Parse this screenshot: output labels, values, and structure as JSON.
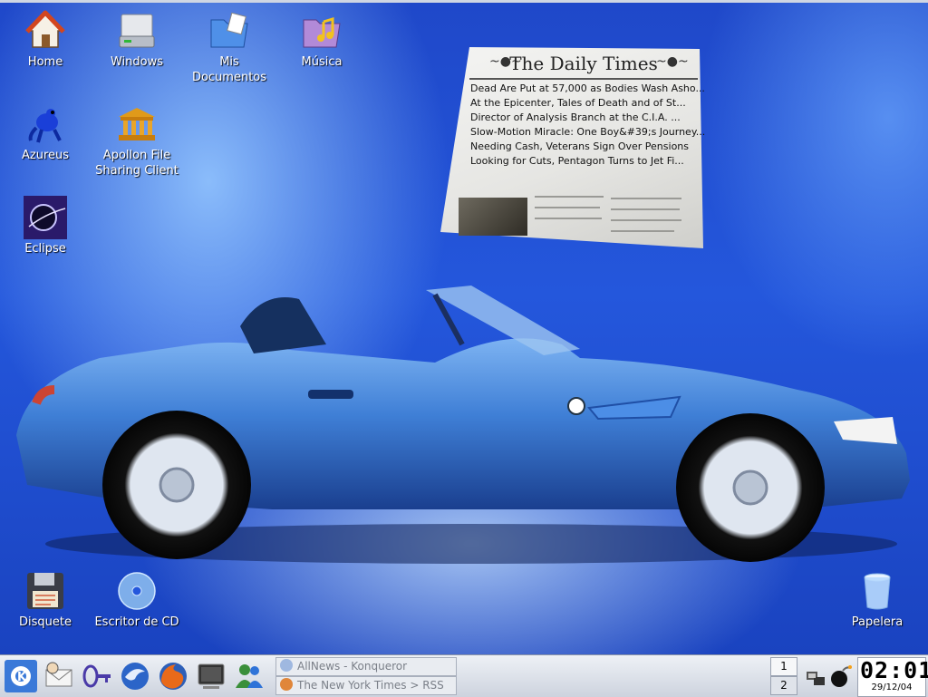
{
  "desktop": {
    "icons": [
      {
        "label": "Home",
        "icon": "home-folder-icon"
      },
      {
        "label": "Windows",
        "icon": "hard-drive-icon"
      },
      {
        "label": "Mis Documentos",
        "icon": "documents-folder-icon"
      },
      {
        "label": "Música",
        "icon": "music-folder-icon"
      },
      {
        "label": "Azureus",
        "icon": "azureus-frog-icon"
      },
      {
        "label": "Apollon File Sharing Client",
        "icon": "apollon-temple-icon"
      },
      {
        "label": "Eclipse",
        "icon": "eclipse-icon"
      },
      {
        "label": "Disquete",
        "icon": "floppy-disk-icon"
      },
      {
        "label": "Escritor de CD",
        "icon": "cd-writer-icon"
      },
      {
        "label": "Papelera",
        "icon": "trash-icon"
      }
    ]
  },
  "newsticker": {
    "title": "The Daily Times",
    "headlines": [
      "Dead Are Put at 57,000 as Bodies Wash Asho...",
      "At the Epicenter, Tales of Death and of St...",
      "Director of Analysis Branch at the C.I.A. ...",
      "Slow-Motion Miracle: One Boy&#39;s Journey...",
      "Needing Cash, Veterans Sign Over Pensions",
      "Looking for Cuts, Pentagon Turns to Jet Fi..."
    ]
  },
  "taskbar": {
    "launchers": [
      {
        "icon": "kde-menu-icon"
      },
      {
        "icon": "kmail-icon"
      },
      {
        "icon": "kgpg-key-icon"
      },
      {
        "icon": "thunderbird-icon"
      },
      {
        "icon": "firefox-icon"
      },
      {
        "icon": "terminal-icon"
      },
      {
        "icon": "messenger-icon"
      }
    ],
    "windows": [
      {
        "label": "AllNews - Konqueror"
      },
      {
        "label": "The New York Times > RSS"
      }
    ],
    "pager": [
      "1",
      "2"
    ],
    "clock": {
      "time": "02:01",
      "date": "29/12/04"
    }
  },
  "colors": {
    "desktop_blue": "#2457dc",
    "car_blue": "#3f7fd6",
    "taskbar": "#dde2ea"
  }
}
